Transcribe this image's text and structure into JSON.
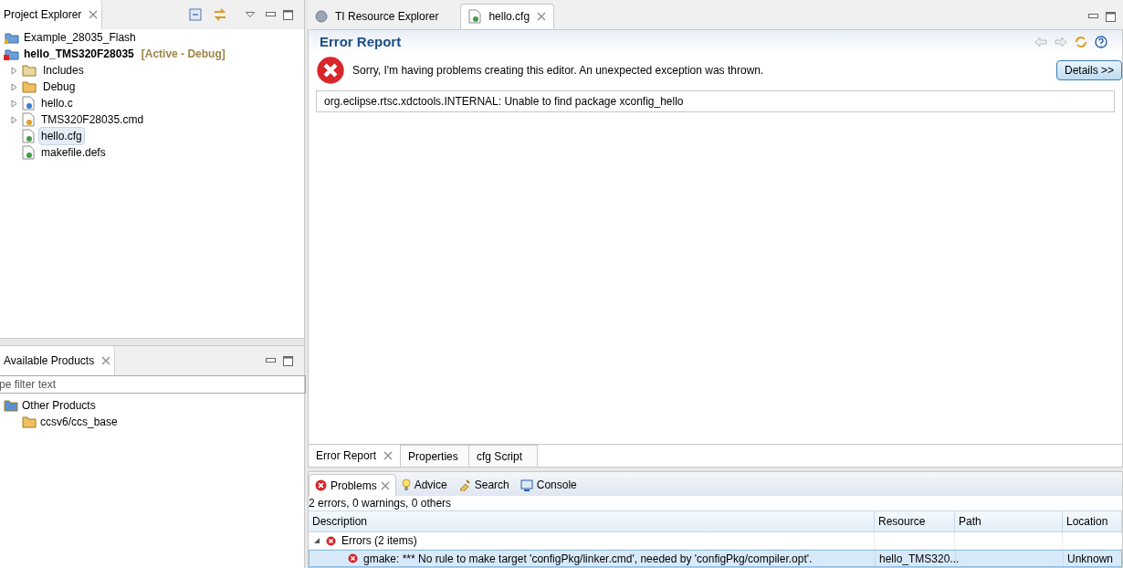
{
  "project_explorer": {
    "title": "Project Explorer",
    "tree": [
      {
        "label": "Example_28035_Flash",
        "bold": false,
        "selected": false
      },
      {
        "label": "hello_TMS320F28035",
        "suffix": "[Active - Debug]",
        "bold": true,
        "selected": false,
        "children": [
          {
            "label": "Includes",
            "kind": "container",
            "expanded": false,
            "selected": false
          },
          {
            "label": "Debug",
            "kind": "container",
            "expanded": false,
            "selected": false
          },
          {
            "label": "hello.c",
            "kind": "container",
            "expanded": false,
            "selected": false
          },
          {
            "label": "TMS320F28035.cmd",
            "kind": "container",
            "expanded": false,
            "selected": false
          },
          {
            "label": "hello.cfg",
            "kind": "file",
            "selected": true
          },
          {
            "label": "makefile.defs",
            "kind": "file",
            "selected": false
          }
        ]
      }
    ]
  },
  "available_products": {
    "title": "Available Products",
    "filter": {
      "placeholder": "pe filter text"
    },
    "tree": [
      {
        "label": "Other Products",
        "children": [
          {
            "label": "ccsv6/ccs_base"
          }
        ]
      }
    ]
  },
  "editor_tabs": [
    {
      "label": "TI Resource Explorer",
      "selected": false
    },
    {
      "label": "hello.cfg",
      "selected": true
    }
  ],
  "error_report": {
    "title": "Error Report",
    "message": "Sorry, I'm having problems creating this editor. An unexpected exception was thrown.",
    "details_button": "Details >>",
    "exception": "org.eclipse.rtsc.xdctools.INTERNAL: Unable to find package xconfig_hello"
  },
  "editor_pages": [
    {
      "label": "Error Report",
      "selected": true
    },
    {
      "label": "Properties",
      "selected": false
    },
    {
      "label": "cfg Script",
      "selected": false
    }
  ],
  "bottom_tabs": [
    {
      "label": "Problems",
      "selected": true
    },
    {
      "label": "Advice",
      "selected": false
    },
    {
      "label": "Search",
      "selected": false
    },
    {
      "label": "Console",
      "selected": false
    }
  ],
  "problems": {
    "summary": "2 errors, 0 warnings, 0 others",
    "columns": [
      "Description",
      "Resource",
      "Path",
      "Location"
    ],
    "groups": [
      {
        "label": "Errors (2 items)",
        "expanded": true,
        "rows": [
          {
            "description": "gmake: *** No rule to make target 'configPkg/linker.cmd', needed by 'configPkg/compiler.opt'.",
            "resource": "hello_TMS320...",
            "location": "Unknown",
            "selected": true
          }
        ]
      }
    ]
  }
}
